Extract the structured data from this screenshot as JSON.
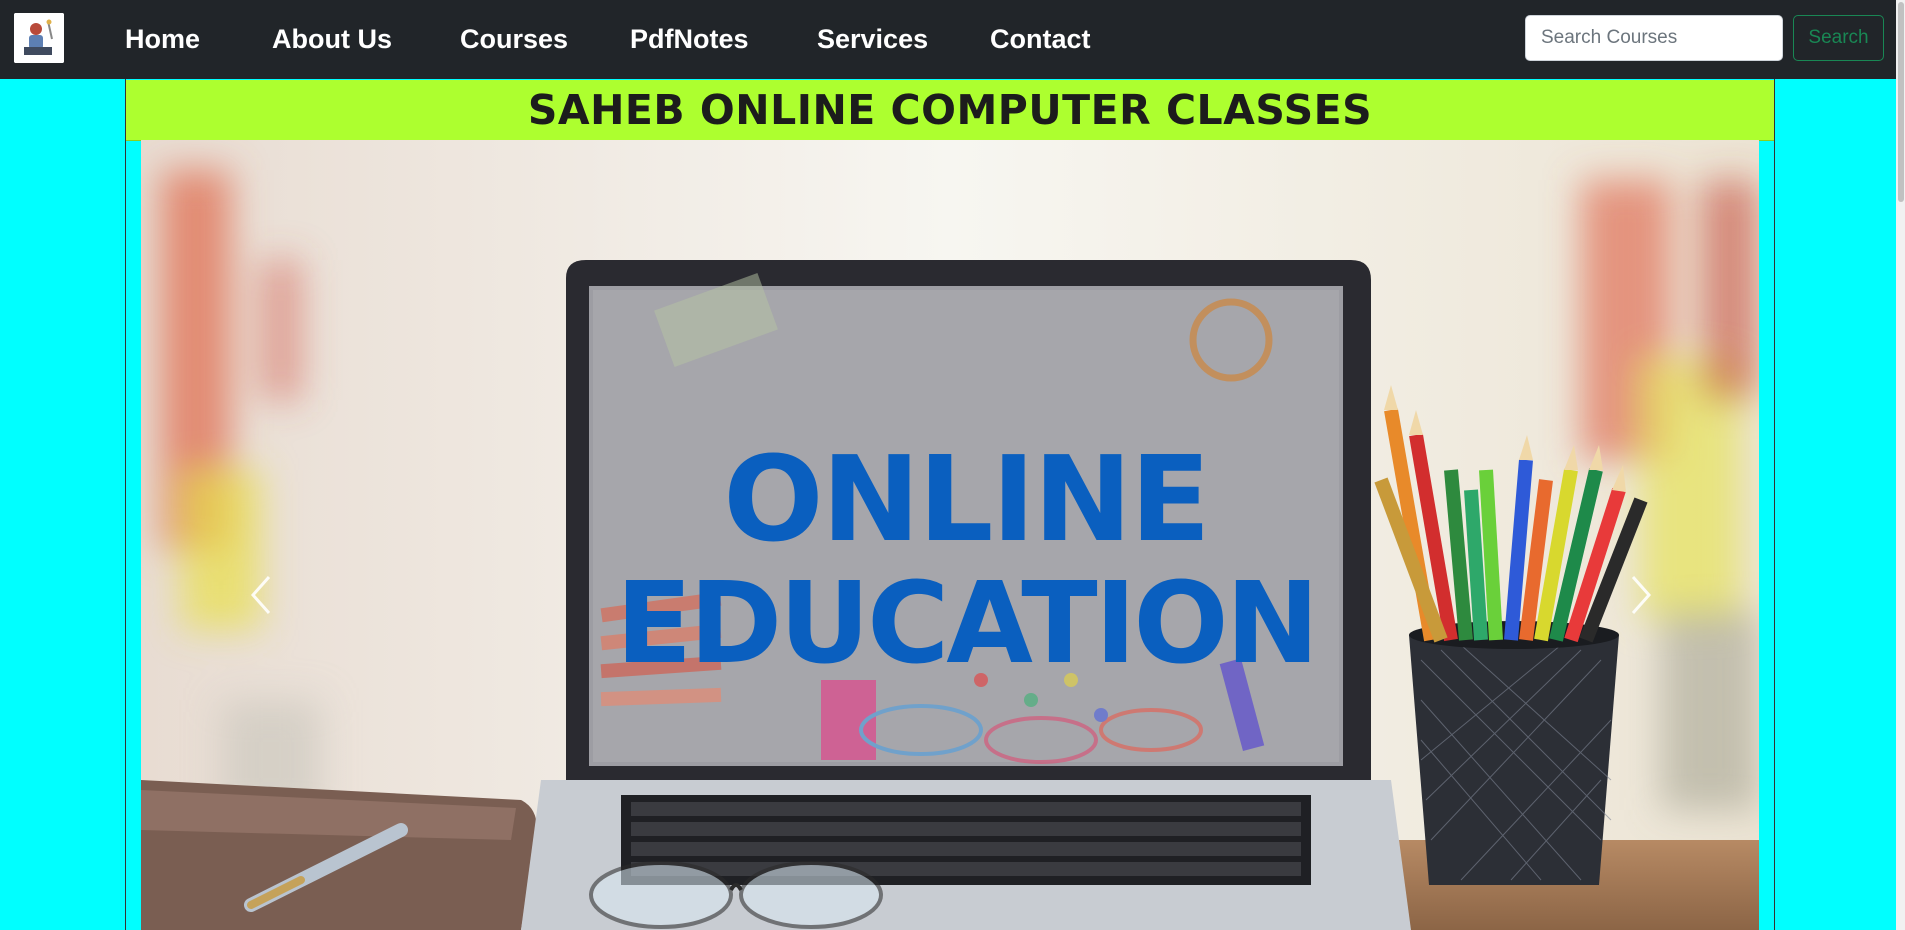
{
  "navbar": {
    "logo_alt": "logo",
    "links": [
      "Home",
      "About Us",
      "Courses",
      "PdfNotes",
      "Services",
      "Contact"
    ],
    "search": {
      "placeholder": "Search Courses",
      "button_label": "Search"
    }
  },
  "banner": {
    "title": "SAHEB ONLINE COMPUTER CLASSES"
  },
  "carousel": {
    "slide_text_line1": "ONLINE",
    "slide_text_line2": "EDUCATION",
    "prev_icon": "chevron-left-icon",
    "next_icon": "chevron-right-icon"
  },
  "colors": {
    "page_bg": "#00ffff",
    "navbar_bg": "#212529",
    "banner_bg": "#adff2f",
    "search_button": "#198754",
    "slide_text": "#0a5fbf"
  }
}
